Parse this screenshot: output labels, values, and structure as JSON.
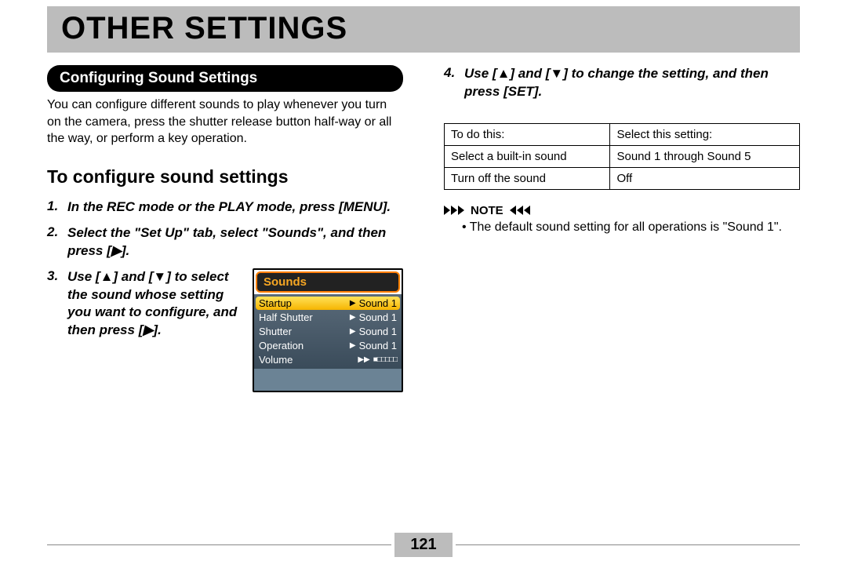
{
  "header": {
    "title": "OTHER SETTINGS"
  },
  "left": {
    "pill": "Configuring Sound Settings",
    "intro": "You can configure different sounds to play whenever you turn on the camera, press the shutter release button half-way or all the way, or perform a key operation.",
    "subhead": "To configure sound settings",
    "steps": [
      {
        "n": "1.",
        "text": "In the REC mode or the PLAY mode, press [MENU]."
      },
      {
        "n": "2.",
        "text": "Select the \"Set Up\" tab, select \"Sounds\", and then press [▶]."
      },
      {
        "n": "3.",
        "text": "Use [▲] and [▼] to select the sound whose setting you want to configure, and then press [▶]."
      }
    ],
    "screenshot": {
      "title": "Sounds",
      "rows": [
        {
          "label": "Startup",
          "value": "Sound 1",
          "selected": true
        },
        {
          "label": "Half Shutter",
          "value": "Sound 1",
          "selected": false
        },
        {
          "label": "Shutter",
          "value": "Sound 1",
          "selected": false
        },
        {
          "label": "Operation",
          "value": "Sound 1",
          "selected": false
        },
        {
          "label": "Volume",
          "value": "",
          "selected": false
        }
      ]
    }
  },
  "right": {
    "step4": {
      "n": "4.",
      "text": "Use [▲] and [▼] to change the setting, and then press [SET]."
    },
    "table": {
      "headers": [
        "To do this:",
        "Select this setting:"
      ],
      "rows": [
        [
          "Select a built-in sound",
          "Sound 1 through Sound 5"
        ],
        [
          "Turn off the sound",
          "Off"
        ]
      ]
    },
    "note_label": "NOTE",
    "note_body": "• The default sound setting for all operations is \"Sound 1\"."
  },
  "footer": {
    "page": "121"
  }
}
